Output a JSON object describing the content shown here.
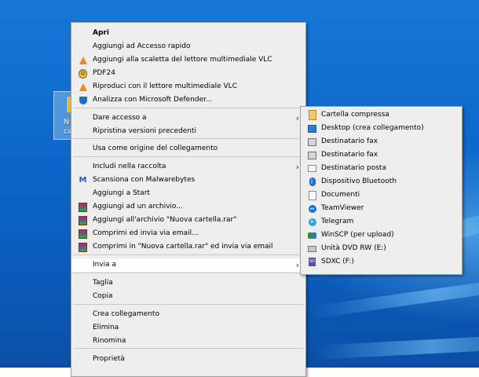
{
  "context_menu": {
    "items": [
      {
        "label": "Apri",
        "icon": null,
        "bold": true,
        "submenu": false
      },
      {
        "label": "Aggiungi ad Accesso rapido",
        "icon": null,
        "submenu": false
      },
      {
        "label": "Aggiungi alla scaletta del lettore multimediale VLC",
        "icon": "vlc-cone-icon",
        "submenu": false
      },
      {
        "label": "PDF24",
        "icon": "pdf24-icon",
        "submenu": false
      },
      {
        "label": "Riproduci con il lettore multimediale VLC",
        "icon": "vlc-cone-icon",
        "submenu": false
      },
      {
        "label": "Analizza con Microsoft Defender...",
        "icon": "defender-shield-icon",
        "submenu": false
      },
      {
        "label": "Dare accesso a",
        "icon": null,
        "submenu": true
      },
      {
        "label": "Ripristina versioni precedenti",
        "icon": null,
        "submenu": false
      },
      {
        "label": "Usa come origine del collegamento",
        "icon": null,
        "submenu": false
      },
      {
        "label": "Includi nella raccolta",
        "icon": null,
        "submenu": true
      },
      {
        "label": "Scansiona con Malwarebytes",
        "icon": "malwarebytes-icon",
        "submenu": false
      },
      {
        "label": "Aggiungi a Start",
        "icon": null,
        "submenu": false
      },
      {
        "label": "Aggiungi ad un archivio...",
        "icon": "winrar-icon",
        "submenu": false
      },
      {
        "label": "Aggiungi all'archivio \"Nuova cartella.rar\"",
        "icon": "winrar-icon",
        "submenu": false
      },
      {
        "label": "Comprimi ed invia via email...",
        "icon": "winrar-icon",
        "submenu": false
      },
      {
        "label": "Comprimi in \"Nuova cartella.rar\" ed invia via email",
        "icon": "winrar-icon",
        "submenu": false
      },
      {
        "label": "Invia a",
        "icon": null,
        "submenu": true,
        "highlighted": true
      },
      {
        "label": "Taglia",
        "icon": null,
        "submenu": false
      },
      {
        "label": "Copia",
        "icon": null,
        "submenu": false
      },
      {
        "label": "Crea collegamento",
        "icon": null,
        "submenu": false
      },
      {
        "label": "Elimina",
        "icon": null,
        "submenu": false
      },
      {
        "label": "Rinomina",
        "icon": null,
        "submenu": false
      },
      {
        "label": "Proprietà",
        "icon": null,
        "submenu": false
      }
    ]
  },
  "sendto_menu": {
    "items": [
      {
        "label": "Cartella compressa",
        "icon": "zip-folder-icon"
      },
      {
        "label": "Desktop (crea collegamento)",
        "icon": "desktop-icon"
      },
      {
        "label": "Destinatario fax",
        "icon": "fax-icon"
      },
      {
        "label": "Destinatario fax",
        "icon": "fax-icon"
      },
      {
        "label": "Destinatario posta",
        "icon": "mail-icon"
      },
      {
        "label": "Dispositivo Bluetooth",
        "icon": "bluetooth-icon"
      },
      {
        "label": "Documenti",
        "icon": "documents-icon"
      },
      {
        "label": "TeamViewer",
        "icon": "teamviewer-icon"
      },
      {
        "label": "Telegram",
        "icon": "telegram-icon"
      },
      {
        "label": "WinSCP (per upload)",
        "icon": "winscp-icon"
      },
      {
        "label": "Unità DVD RW (E:)",
        "icon": "dvd-drive-icon"
      },
      {
        "label": "SDXC (F:)",
        "icon": "sd-card-icon"
      }
    ]
  },
  "desktop_icon": {
    "label": "N\nca"
  },
  "colors": {
    "menu_bg": "#eeeeee",
    "menu_highlight": "#ffffff",
    "desktop_blue": "#0b66c8"
  }
}
